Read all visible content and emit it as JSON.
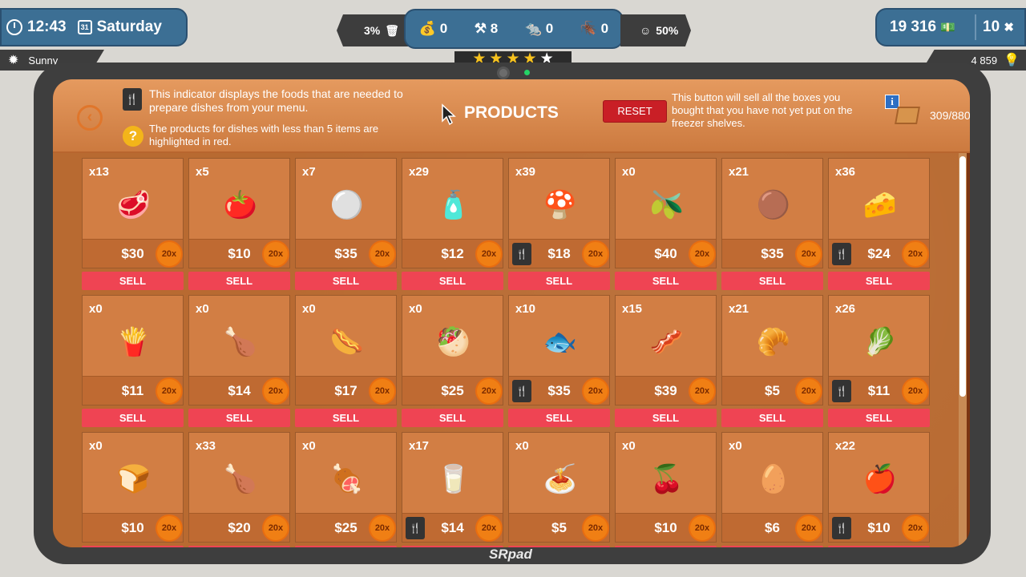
{
  "hud": {
    "time": "12:43",
    "calendar_day": "31",
    "day": "Saturday",
    "weather": "Sunny",
    "trash_percent": "3%",
    "bags": "0",
    "tools": "8",
    "rats": "0",
    "bugs": "0",
    "satisfaction": "50%",
    "money": "19 316",
    "gems": "10",
    "bulbs": "4 859",
    "stars_filled": 4,
    "stars_total": 5
  },
  "header": {
    "title": "PRODUCTS",
    "hint_menu": "This indicator displays the foods that are needed to prepare dishes from your menu.",
    "hint_red": "The products for dishes with less than 5 items are highlighted in red.",
    "reset_label": "RESET",
    "reset_hint": "This button will sell all the boxes you bought that you have not yet put on the freezer shelves.",
    "capacity": "309/880"
  },
  "device_brand": "SRpad",
  "sell_label": "SELL",
  "badge_label": "20x",
  "products": [
    {
      "qty": "x13",
      "price": "$30",
      "menu": false,
      "icon": "salami-icon",
      "glyph": "🥩"
    },
    {
      "qty": "x5",
      "price": "$10",
      "menu": false,
      "icon": "tomato-icon",
      "glyph": "🍅"
    },
    {
      "qty": "x7",
      "price": "$35",
      "menu": false,
      "icon": "mozzarella-icon",
      "glyph": "⚪"
    },
    {
      "qty": "x29",
      "price": "$12",
      "menu": false,
      "icon": "ketchup-icon",
      "glyph": "🧴"
    },
    {
      "qty": "x39",
      "price": "$18",
      "menu": true,
      "icon": "mushroom-icon",
      "glyph": "🍄"
    },
    {
      "qty": "x0",
      "price": "$40",
      "menu": false,
      "icon": "olive-icon",
      "glyph": "🫒"
    },
    {
      "qty": "x21",
      "price": "$35",
      "menu": false,
      "icon": "burger-patty-icon",
      "glyph": "🟤"
    },
    {
      "qty": "x36",
      "price": "$24",
      "menu": true,
      "icon": "cheese-icon",
      "glyph": "🧀"
    },
    {
      "qty": "x0",
      "price": "$11",
      "menu": false,
      "icon": "fries-icon",
      "glyph": "🍟"
    },
    {
      "qty": "x0",
      "price": "$14",
      "menu": false,
      "icon": "nuggets-icon",
      "glyph": "🍗"
    },
    {
      "qty": "x0",
      "price": "$17",
      "menu": false,
      "icon": "sausage-icon",
      "glyph": "🌭"
    },
    {
      "qty": "x0",
      "price": "$25",
      "menu": false,
      "icon": "kebab-meat-icon",
      "glyph": "🥙"
    },
    {
      "qty": "x10",
      "price": "$35",
      "menu": true,
      "icon": "fish-icon",
      "glyph": "🐟"
    },
    {
      "qty": "x15",
      "price": "$39",
      "menu": false,
      "icon": "ham-icon",
      "glyph": "🥓"
    },
    {
      "qty": "x21",
      "price": "$5",
      "menu": false,
      "icon": "dough-icon",
      "glyph": "🥐"
    },
    {
      "qty": "x26",
      "price": "$11",
      "menu": true,
      "icon": "lettuce-icon",
      "glyph": "🥬"
    },
    {
      "qty": "x0",
      "price": "$10",
      "menu": false,
      "icon": "bread-icon",
      "glyph": "🍞"
    },
    {
      "qty": "x33",
      "price": "$20",
      "menu": false,
      "icon": "chicken-leg-icon",
      "glyph": "🍗"
    },
    {
      "qty": "x0",
      "price": "$25",
      "menu": false,
      "icon": "whole-chicken-icon",
      "glyph": "🍖"
    },
    {
      "qty": "x17",
      "price": "$14",
      "menu": true,
      "icon": "milk-pack-icon",
      "glyph": "🥛"
    },
    {
      "qty": "x0",
      "price": "$5",
      "menu": false,
      "icon": "pasta-icon",
      "glyph": "🍝"
    },
    {
      "qty": "x0",
      "price": "$10",
      "menu": false,
      "icon": "cherry-icon",
      "glyph": "🍒"
    },
    {
      "qty": "x0",
      "price": "$6",
      "menu": false,
      "icon": "eggs-icon",
      "glyph": "🥚"
    },
    {
      "qty": "x22",
      "price": "$10",
      "menu": true,
      "icon": "apple-icon",
      "glyph": "🍎"
    }
  ]
}
